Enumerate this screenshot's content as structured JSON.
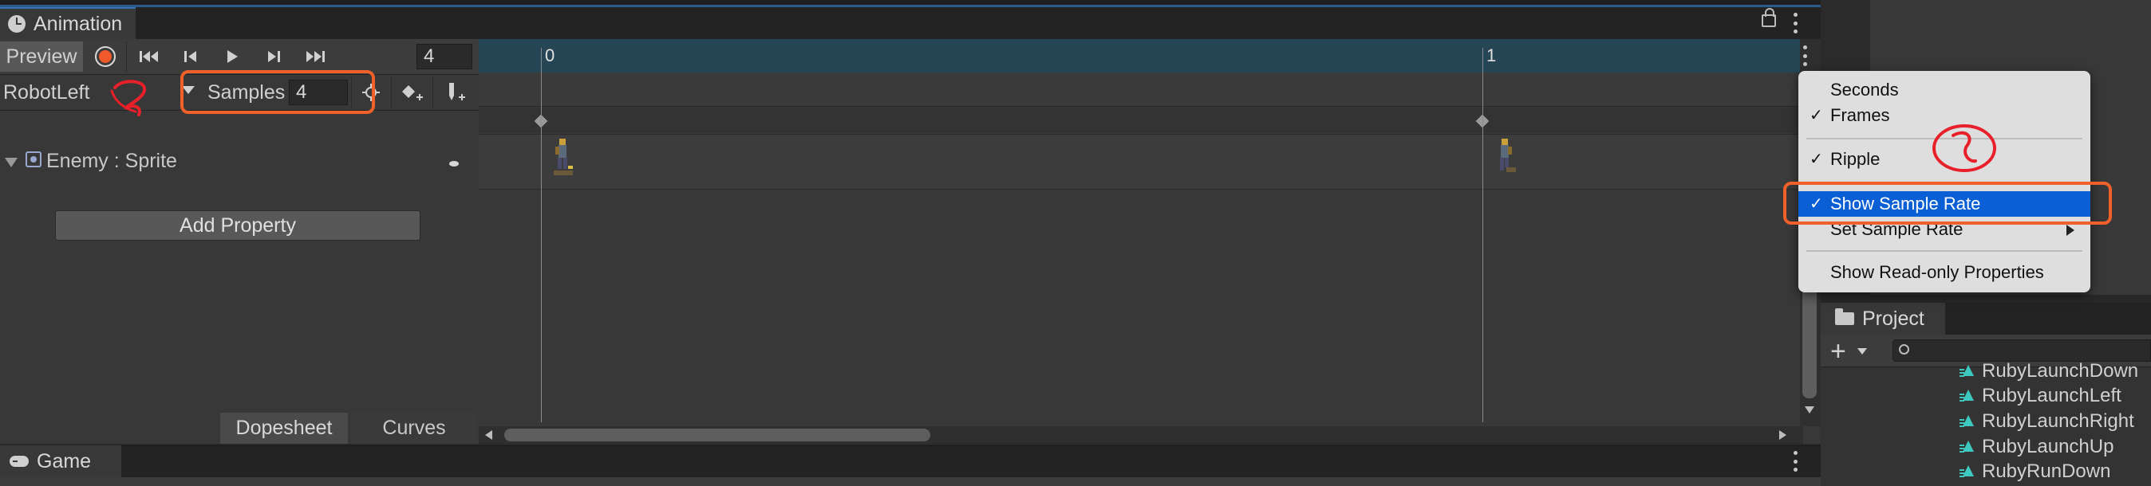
{
  "animation_window": {
    "tab_label": "Animation",
    "preview_label": "Preview",
    "frame_value": "4",
    "clip_name": "RobotLeft",
    "samples_label": "Samples",
    "samples_value": "4",
    "property_name": "Enemy : Sprite",
    "add_property_label": "Add Property",
    "bottom_tabs": [
      "Dopesheet",
      "Curves"
    ],
    "ruler_labels": [
      "0",
      "1"
    ]
  },
  "context_menu": {
    "items": [
      {
        "label": "Seconds",
        "checked": false
      },
      {
        "label": "Frames",
        "checked": true
      },
      {
        "label": "Ripple",
        "checked": true
      },
      {
        "label": "Show Sample Rate",
        "checked": true,
        "highlighted": true
      },
      {
        "label": "Set Sample Rate",
        "checked": false,
        "submenu": true
      },
      {
        "label": "Show Read-only Properties",
        "checked": false
      }
    ]
  },
  "project_panel": {
    "tab_label": "Project",
    "assets": [
      "RubyLaunchDown",
      "RubyLaunchLeft",
      "RubyLaunchRight",
      "RubyLaunchUp",
      "RubyRunDown"
    ]
  },
  "game_panel": {
    "tab_label": "Game"
  },
  "annotations": {
    "accent_color": "#f0602a",
    "selection_color": "#0a5fd4"
  }
}
